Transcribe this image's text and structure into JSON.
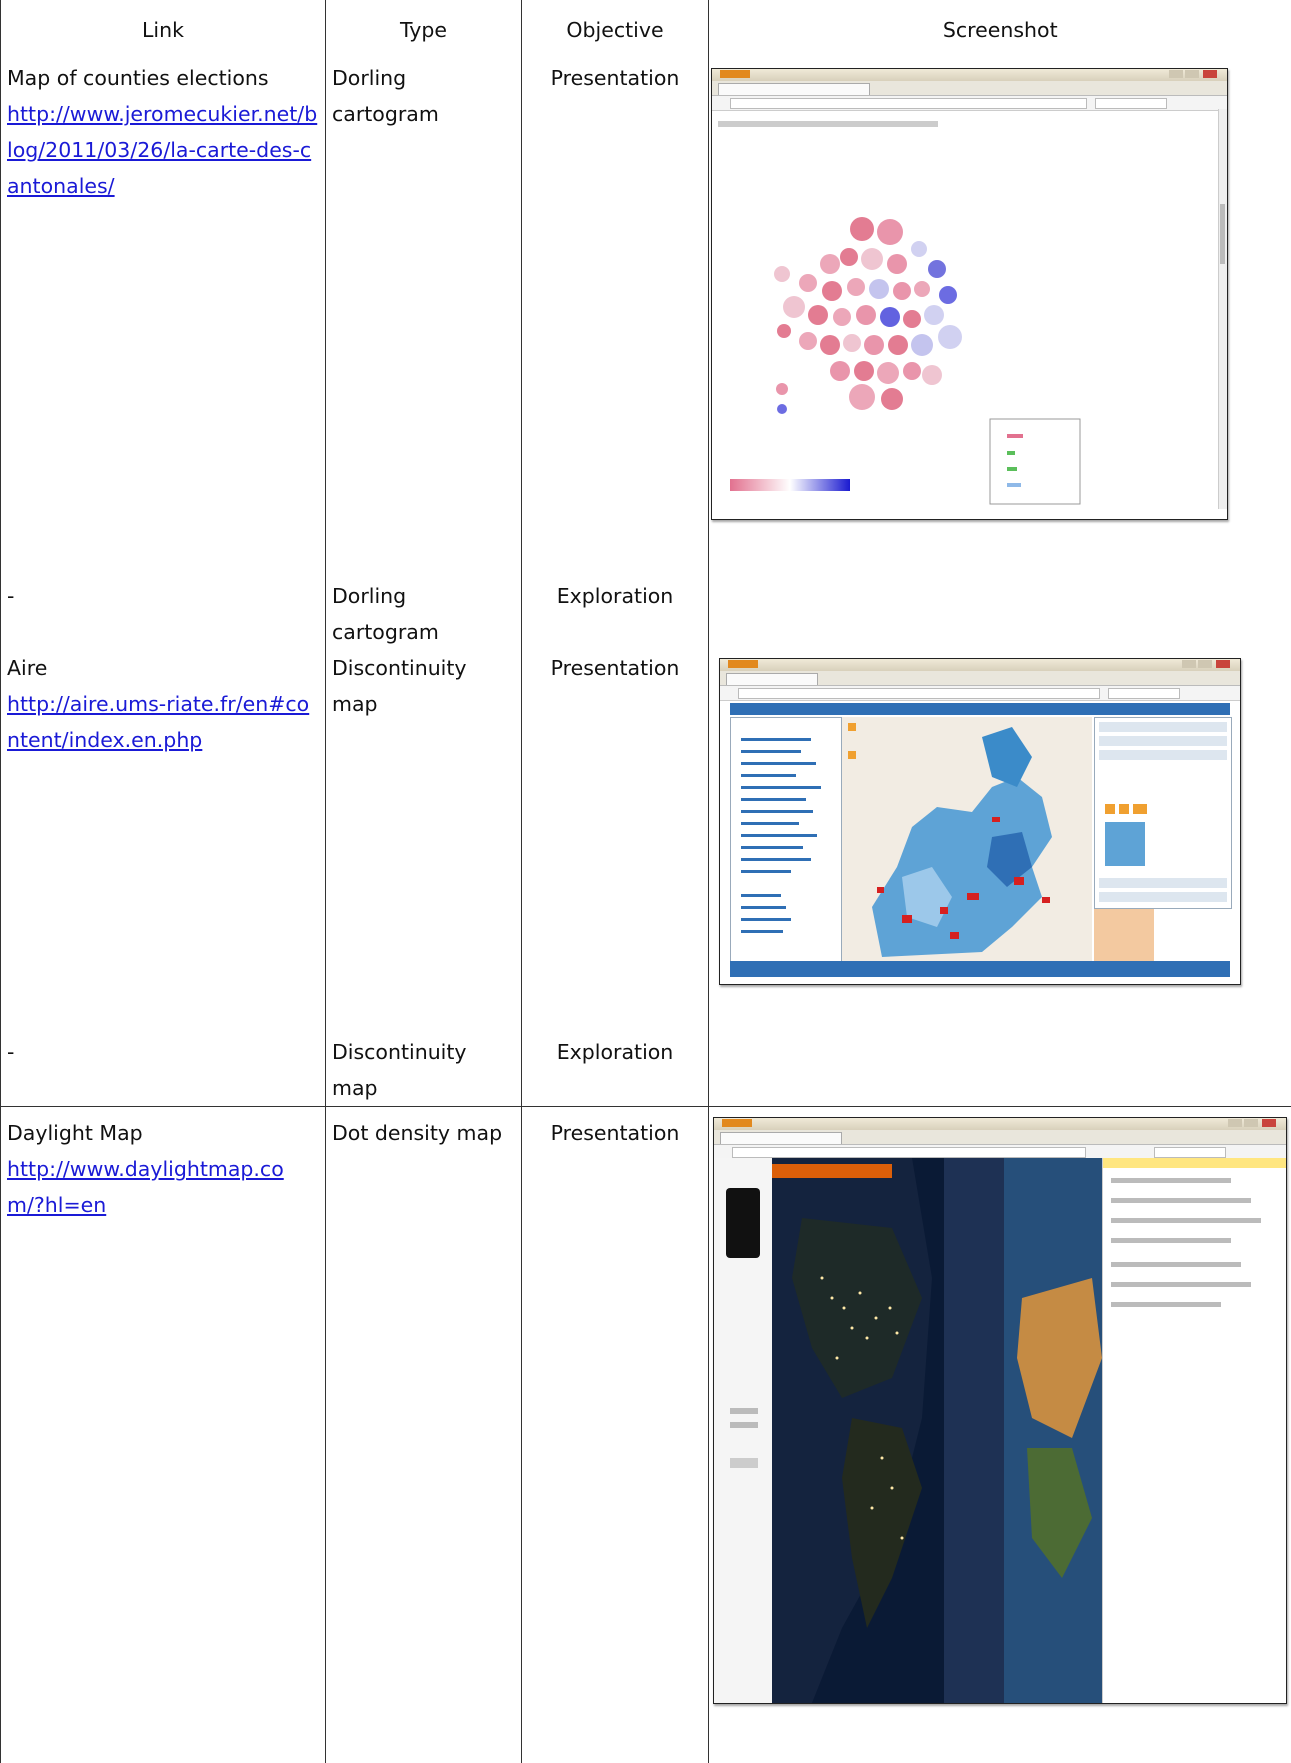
{
  "table": {
    "headers": {
      "link": "Link",
      "type": "Type",
      "objective": "Objective",
      "screenshot": "Screenshot"
    },
    "rows": [
      {
        "title": "Map of counties elections",
        "url": "http://www.jeromecukier.net/blog/2011/03/26/la-carte-des-cantonales/",
        "type": "Dorling cartogram",
        "objective": "Presentation"
      },
      {
        "title": "-",
        "type": "Dorling cartogram",
        "objective": "Exploration"
      },
      {
        "title": "Aire",
        "url": "http://aire.ums-riate.fr/en#content/index.en.php",
        "type": "Discontinuity map",
        "objective": "Presentation"
      },
      {
        "title": "-",
        "type": "Discontinuity map",
        "objective": "Exploration"
      },
      {
        "title": "Daylight Map",
        "url": "http://www.daylightmap.com/?hl=en",
        "type": "Dot density map",
        "objective": "Presentation"
      }
    ]
  },
  "colors": {
    "link": "#1a1ad6",
    "cartogram_red": "#e2718f",
    "cartogram_blue": "#3b3bd8",
    "aire_blue": "#2f6fb5",
    "aire_red": "#d62020",
    "night_sea": "#0a1a35",
    "daylight_orange": "#ff6a00"
  }
}
